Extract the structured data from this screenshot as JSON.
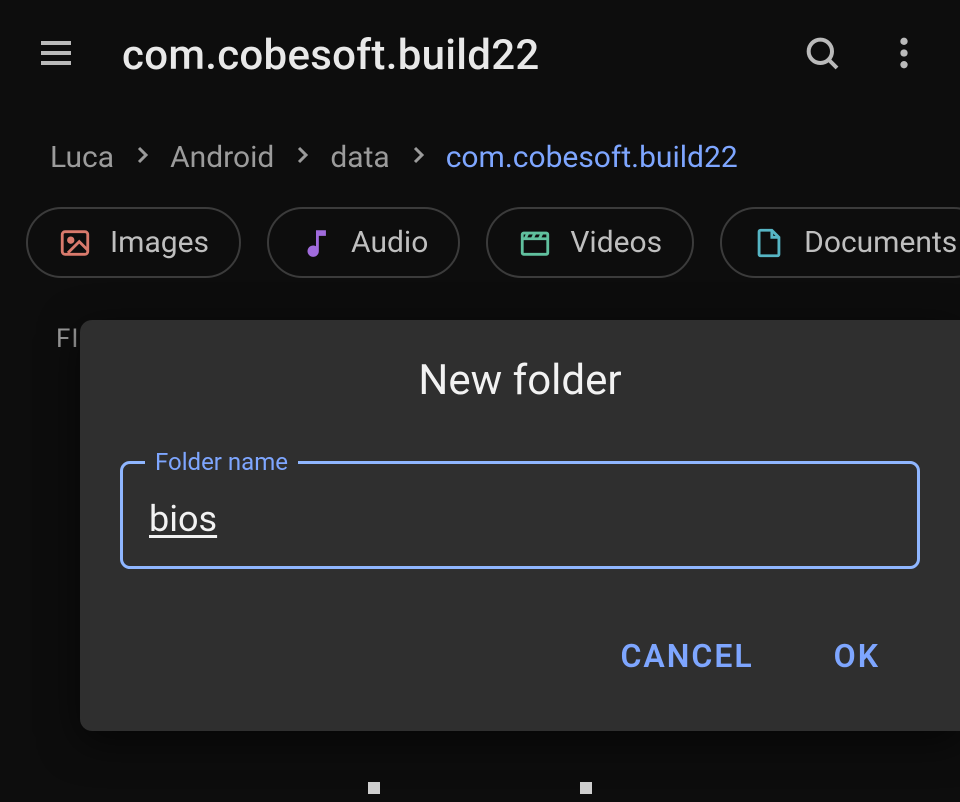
{
  "appbar": {
    "title": "com.cobesoft.build22"
  },
  "breadcrumb": {
    "items": [
      {
        "label": "Luca",
        "active": false
      },
      {
        "label": "Android",
        "active": false
      },
      {
        "label": "data",
        "active": false
      },
      {
        "label": "com.cobesoft.build22",
        "active": true
      }
    ]
  },
  "chips": [
    {
      "label": "Images",
      "icon": "image-icon",
      "color": "#d97a6c"
    },
    {
      "label": "Audio",
      "icon": "music-note-icon",
      "color": "#a06bdc"
    },
    {
      "label": "Videos",
      "icon": "clapperboard-icon",
      "color": "#60c09e"
    },
    {
      "label": "Documents",
      "icon": "document-icon",
      "color": "#56b5c4"
    }
  ],
  "section": {
    "label": "FI"
  },
  "dialog": {
    "title": "New folder",
    "field_label": "Folder name",
    "field_value": "bios",
    "cancel_label": "CANCEL",
    "ok_label": "OK"
  }
}
